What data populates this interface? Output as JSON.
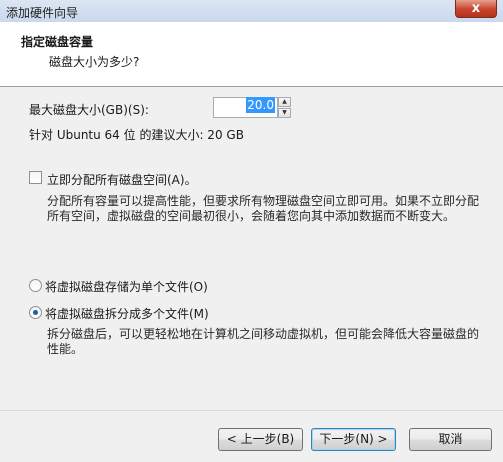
{
  "window": {
    "title": "添加硬件向导",
    "close_label": "x"
  },
  "header": {
    "title": "指定磁盘容量",
    "subtitle": "磁盘大小为多少?"
  },
  "disk_size": {
    "label": "最大磁盘大小(GB)(S):",
    "value": "20.0",
    "recommended": "针对 Ubuntu 64 位 的建议大小: 20 GB"
  },
  "allocate": {
    "checked": false,
    "label": "立即分配所有磁盘空间(A)。",
    "desc_line1": "分配所有容量可以提高性能，但要求所有物理磁盘空间立即可用。如果不立即分配",
    "desc_line2": "所有空间，虚拟磁盘的空间最初很小，会随着您向其中添加数据而不断变大。"
  },
  "storage": {
    "single_label": "将虚拟磁盘存储为单个文件(O)",
    "single_selected": false,
    "split_label": "将虚拟磁盘拆分成多个文件(M)",
    "split_selected": true,
    "split_desc_line1": "拆分磁盘后，可以更轻松地在计算机之间移动虚拟机，但可能会降低大容量磁盘的",
    "split_desc_line2": "性能。"
  },
  "buttons": {
    "back": "< 上一步(B)",
    "next": "下一步(N) >",
    "cancel": "取消"
  }
}
